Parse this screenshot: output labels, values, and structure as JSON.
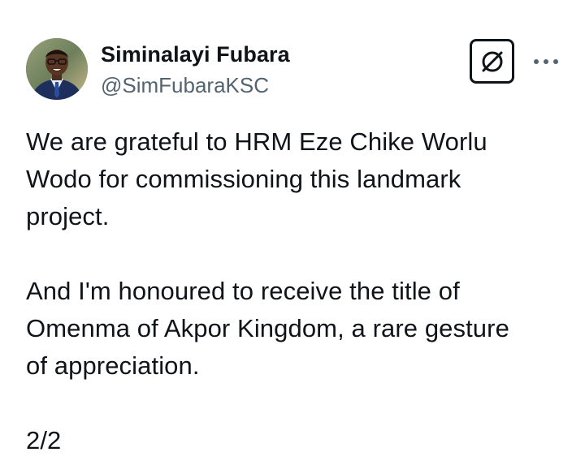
{
  "author": {
    "display_name": "Siminalayi Fubara",
    "handle": "@SimFubaraKSC",
    "avatar_icon": "profile-photo"
  },
  "actions": {
    "grok_icon": "grok-icon",
    "more_icon": "more-horizontal-icon"
  },
  "tweet": {
    "paragraphs": [
      "We are grateful to HRM Eze Chike Worlu\nWodo for commissioning this landmark\nproject.",
      "And I'm honoured to receive the title of\nOmenma of Akpor Kingdom, a rare gesture\nof appreciation.",
      "2/2"
    ]
  },
  "colors": {
    "text": "#0f1419",
    "secondary_text": "#536471",
    "background": "#ffffff"
  }
}
